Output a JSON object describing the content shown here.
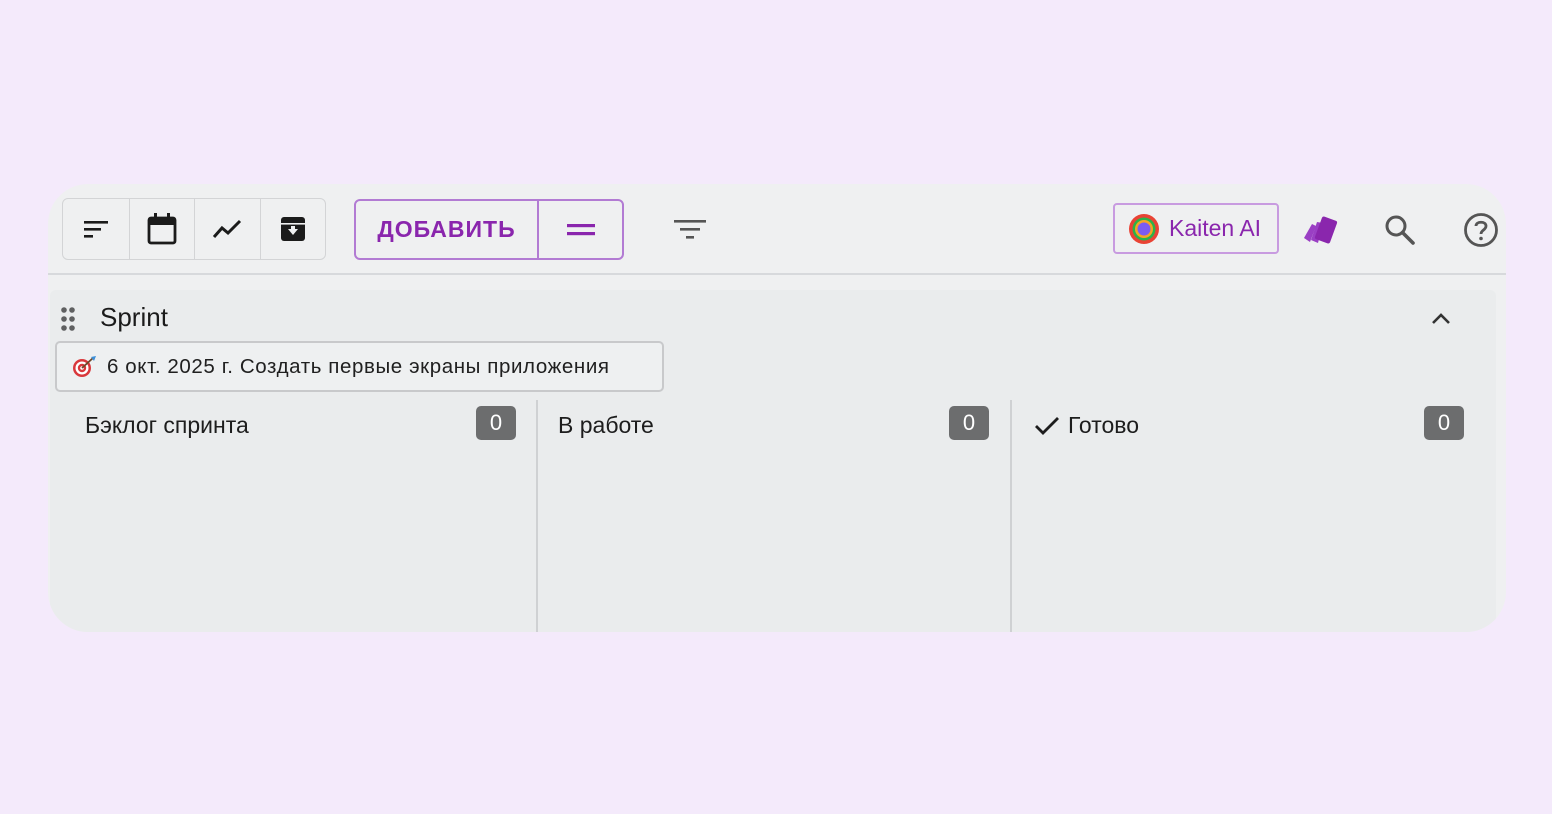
{
  "toolbar": {
    "tools": [
      {
        "name": "sort-icon"
      },
      {
        "name": "calendar-icon"
      },
      {
        "name": "chart-line-icon"
      },
      {
        "name": "archive-icon"
      }
    ],
    "add_label": "ДОБАВИТЬ",
    "add_menu_icon": "equal-icon",
    "filter_icon": "filter-icon",
    "ai_label": "Kaiten AI",
    "ai_icon": "kaiten-ai-logo",
    "cards_icon": "cards-icon",
    "search_icon": "search-icon",
    "help_icon": "help-icon"
  },
  "board": {
    "title": "Sprint",
    "sprint_goal": "6 окт. 2025 г. Создать первые экраны приложения",
    "sprint_goal_icon": "target-icon",
    "columns": [
      {
        "title": "Бэклог спринта",
        "count": "0"
      },
      {
        "title": "В работе",
        "count": "0"
      },
      {
        "title": "Готово",
        "count": "0",
        "icon": "check-icon"
      }
    ]
  },
  "colors": {
    "accent": "#8a26ad",
    "background": "#f4eafb",
    "badge": "#6c6d6e"
  }
}
